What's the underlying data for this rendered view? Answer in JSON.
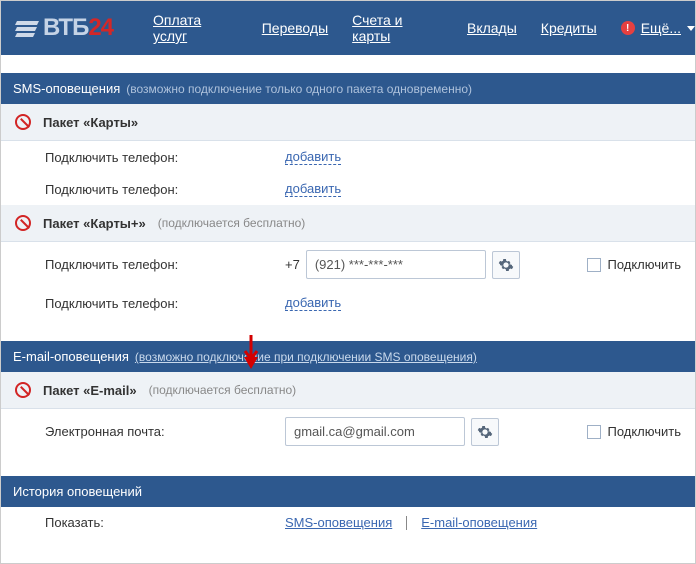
{
  "brand": {
    "text1": "ВТБ",
    "text2": "24"
  },
  "nav": {
    "pay": "Оплата услуг",
    "transfer": "Переводы",
    "cards": "Счета и карты",
    "deposits": "Вклады",
    "credits": "Кредиты",
    "more": "Ещё...",
    "alert": "!"
  },
  "sms": {
    "title": "SMS-оповещения",
    "note": "(возможно подключение только одного пакета одновременно)",
    "pkg1": "Пакет «Карты»",
    "pkg2": "Пакет «Карты+»",
    "pkg2_note": "(подключается бесплатно)",
    "lbl_phone": "Подключить телефон:",
    "add_link": "добавить",
    "prefix": "+7",
    "masked": "(921) ***-***-***",
    "connect": "Подключить"
  },
  "email": {
    "title": "E-mail-оповещения",
    "note": "(возможно подключение при подключении SMS оповещения)",
    "pkg": "Пакет «E-mail»",
    "pkg_note": "(подключается бесплатно)",
    "lbl": "Электронная почта:",
    "val": "gmail.ca@gmail.com",
    "connect": "Подключить"
  },
  "history": {
    "title": "История оповещений",
    "show": "Показать:",
    "sms": "SMS-оповещения",
    "email": "E-mail-оповещения"
  }
}
